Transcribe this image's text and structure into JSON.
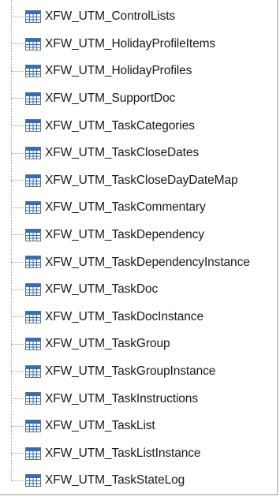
{
  "tree": {
    "icon": "table-grid-icon",
    "colors": {
      "icon_header": "#2f6fb8",
      "icon_cell": "#ffffff",
      "icon_border": "#6f6f6f",
      "guide_line": "#a0a0a0",
      "text": "#1a1a1a"
    },
    "items": [
      {
        "label": "XFW_UTM_ControlLists"
      },
      {
        "label": "XFW_UTM_HolidayProfileItems"
      },
      {
        "label": "XFW_UTM_HolidayProfiles"
      },
      {
        "label": "XFW_UTM_SupportDoc"
      },
      {
        "label": "XFW_UTM_TaskCategories"
      },
      {
        "label": "XFW_UTM_TaskCloseDates"
      },
      {
        "label": "XFW_UTM_TaskCloseDayDateMap"
      },
      {
        "label": "XFW_UTM_TaskCommentary"
      },
      {
        "label": "XFW_UTM_TaskDependency"
      },
      {
        "label": "XFW_UTM_TaskDependencyInstance"
      },
      {
        "label": "XFW_UTM_TaskDoc"
      },
      {
        "label": "XFW_UTM_TaskDocInstance"
      },
      {
        "label": "XFW_UTM_TaskGroup"
      },
      {
        "label": "XFW_UTM_TaskGroupInstance"
      },
      {
        "label": "XFW_UTM_TaskInstructions"
      },
      {
        "label": "XFW_UTM_TaskList"
      },
      {
        "label": "XFW_UTM_TaskListInstance"
      },
      {
        "label": "XFW_UTM_TaskStateLog"
      }
    ]
  }
}
